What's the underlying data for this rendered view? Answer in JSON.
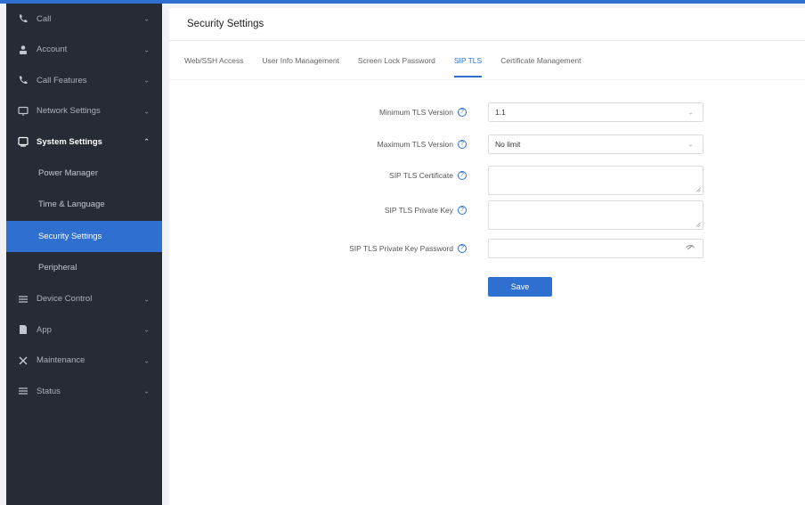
{
  "sidebar": {
    "items": [
      {
        "label": "Call",
        "icon": "phone-icon",
        "expanded": false
      },
      {
        "label": "Account",
        "icon": "user-icon",
        "expanded": false
      },
      {
        "label": "Call Features",
        "icon": "phone-handset-icon",
        "expanded": false
      },
      {
        "label": "Network Settings",
        "icon": "network-icon",
        "expanded": false
      },
      {
        "label": "System Settings",
        "icon": "system-settings-icon",
        "expanded": true,
        "children": [
          {
            "label": "Power Manager"
          },
          {
            "label": "Time & Language"
          },
          {
            "label": "Security Settings",
            "active": true
          },
          {
            "label": "Peripheral"
          }
        ]
      },
      {
        "label": "Device Control",
        "icon": "list-icon",
        "expanded": false
      },
      {
        "label": "App",
        "icon": "app-icon",
        "expanded": false
      },
      {
        "label": "Maintenance",
        "icon": "tools-icon",
        "expanded": false
      },
      {
        "label": "Status",
        "icon": "list-icon",
        "expanded": false
      }
    ]
  },
  "header": {
    "title": "Security Settings"
  },
  "tabs": [
    {
      "label": "Web/SSH Access"
    },
    {
      "label": "User Info Management"
    },
    {
      "label": "Screen Lock Password"
    },
    {
      "label": "SIP TLS",
      "active": true
    },
    {
      "label": "Certificate Management"
    }
  ],
  "form": {
    "min_tls_label": "Minimum TLS Version",
    "min_tls_value": "1.1",
    "max_tls_label": "Maximum TLS Version",
    "max_tls_value": "No limit",
    "cert_label": "SIP TLS Certificate",
    "cert_value": "",
    "key_label": "SIP TLS Private Key",
    "key_value": "",
    "key_password_label": "SIP TLS Private Key Password",
    "key_password_value": "",
    "save_label": "Save"
  },
  "colors": {
    "accent": "#2f6fd0",
    "sidebar_bg": "#262b36",
    "page_bg": "#f0f2f5"
  }
}
